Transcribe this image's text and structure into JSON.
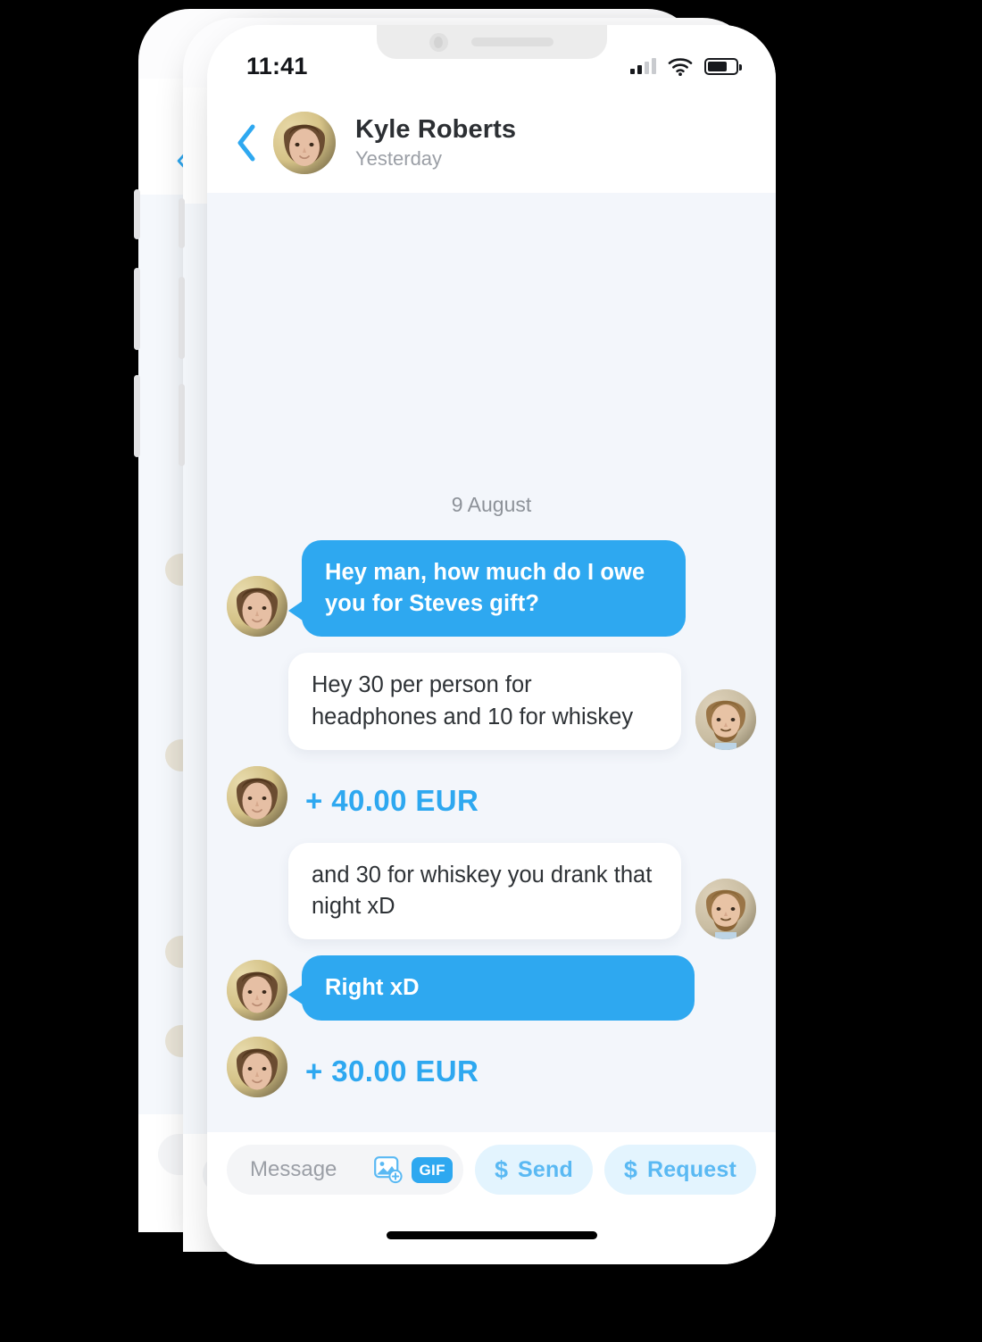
{
  "status_bar": {
    "time": "11:41",
    "signal_icon": "signal-bars-icon",
    "wifi_icon": "wifi-icon",
    "battery_icon": "battery-icon",
    "battery_level": 70
  },
  "header": {
    "back_icon": "back-chevron-icon",
    "avatar_icon": "contact-avatar",
    "name": "Kyle Roberts",
    "subtitle": "Yesterday"
  },
  "chat": {
    "date_separator": "9 August",
    "messages": [
      {
        "id": 1,
        "type": "bubble",
        "side": "left",
        "style": "blue",
        "text": "Hey man, how much do I owe you for Steves gift?",
        "avatar": "kyle-avatar"
      },
      {
        "id": 2,
        "type": "bubble",
        "side": "right",
        "style": "white",
        "text": "Hey 30 per person for headphones and 10 for whiskey",
        "avatar": "friend-avatar"
      },
      {
        "id": 3,
        "type": "amount",
        "side": "left",
        "text": "+ 40.00 EUR",
        "avatar": "kyle-avatar"
      },
      {
        "id": 4,
        "type": "bubble",
        "side": "right",
        "style": "white",
        "text": "and 30 for whiskey you drank that night xD",
        "avatar": "friend-avatar"
      },
      {
        "id": 5,
        "type": "bubble",
        "side": "left",
        "style": "blue",
        "text": "Right xD",
        "avatar": "kyle-avatar"
      },
      {
        "id": 6,
        "type": "amount",
        "side": "left",
        "text": "+ 30.00 EUR",
        "avatar": "kyle-avatar"
      }
    ]
  },
  "input_bar": {
    "placeholder": "Message",
    "image_icon": "image-upload-icon",
    "gif_label": "GIF",
    "send": {
      "currency_symbol": "$",
      "label": "Send"
    },
    "request": {
      "currency_symbol": "$",
      "label": "Request"
    }
  },
  "colors": {
    "accent": "#2ea8f0",
    "accent_soft": "#5ab9f3",
    "action_bg": "#e3f4fe",
    "chat_bg": "#f3f6fb",
    "bubble_incoming": "#ffffff",
    "text_primary": "#2c2f33",
    "text_muted": "#9b9fa6"
  }
}
